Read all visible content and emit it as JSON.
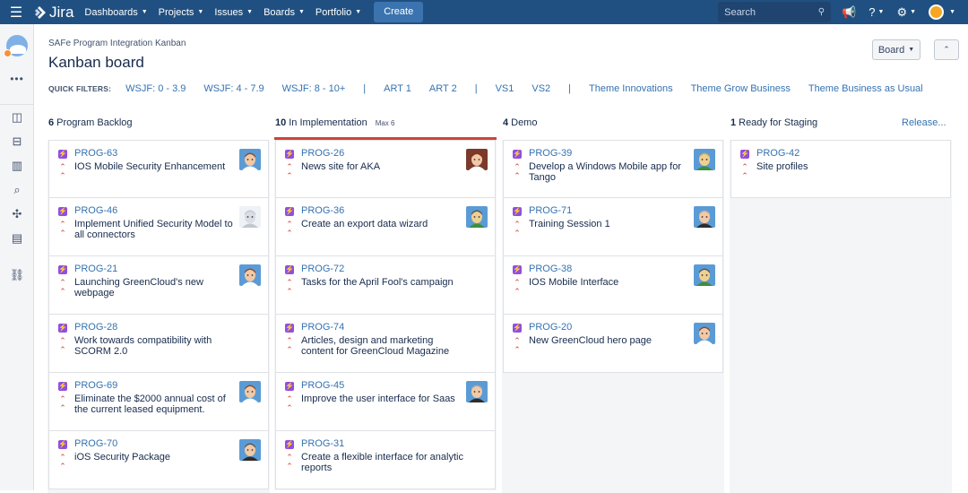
{
  "topbar": {
    "logo_text": "Jira",
    "nav": [
      "Dashboards",
      "Projects",
      "Issues",
      "Boards",
      "Portfolio"
    ],
    "create_label": "Create",
    "search_placeholder": "Search"
  },
  "header": {
    "breadcrumb": "SAFe Program Integration Kanban",
    "title": "Kanban board",
    "board_button": "Board"
  },
  "quick_filters": {
    "label": "QUICK FILTERS:",
    "items": [
      "WSJF: 0 - 3.9",
      "WSJF: 4 - 7.9",
      "WSJF: 8 - 10+",
      "|",
      "ART 1",
      "ART 2",
      "|",
      "VS1",
      "VS2",
      "|",
      "Theme Innovations",
      "Theme Grow Business",
      "Theme Business as Usual"
    ]
  },
  "columns": [
    {
      "count": "6",
      "name": "Program Backlog",
      "max": "",
      "cards": [
        {
          "key": "PROG-63",
          "summary": "IOS Mobile Security Enhancement",
          "avatar": {
            "skin": "#f2c9a6",
            "hair": "#8b4a2b",
            "bg": "#5b9bd5",
            "shirt": "#ffffff"
          }
        },
        {
          "key": "PROG-46",
          "summary": "Implement Unified Security Model to all connectors",
          "avatar": {
            "skin": "#d8dde6",
            "hair": "#c1c7d0",
            "bg": "#eef1f5",
            "shirt": "#c1c7d0"
          }
        },
        {
          "key": "PROG-21",
          "summary": "Launching GreenCloud's new webpage",
          "avatar": {
            "skin": "#f2c9a6",
            "hair": "#8b4a2b",
            "bg": "#5b9bd5",
            "shirt": "#ffffff"
          }
        },
        {
          "key": "PROG-28",
          "summary": "Work towards compatibility with SCORM 2.0",
          "avatar": null
        },
        {
          "key": "PROG-69",
          "summary": "Eliminate the $2000 annual cost of the current leased equipment.",
          "avatar": {
            "skin": "#f2c9a6",
            "hair": "#8b4a2b",
            "bg": "#5b9bd5",
            "shirt": "#ffffff"
          }
        },
        {
          "key": "PROG-70",
          "summary": "iOS Security Package",
          "avatar": {
            "skin": "#f2c9a6",
            "hair": "#555555",
            "bg": "#5b9bd5",
            "shirt": "#2d2d2d"
          }
        }
      ]
    },
    {
      "count": "10",
      "name": "In Implementation",
      "max": "Max 6",
      "cards": [
        {
          "key": "PROG-26",
          "summary": "News site for AKA",
          "avatar": {
            "skin": "#f2c9a6",
            "hair": "#8b2f1a",
            "bg": "#7a3b2b",
            "shirt": "#ffffff"
          }
        },
        {
          "key": "PROG-36",
          "summary": "Create an export data wizard",
          "avatar": {
            "skin": "#f0d090",
            "hair": "#555555",
            "bg": "#5b9bd5",
            "shirt": "#3f8e3f"
          }
        },
        {
          "key": "PROG-72",
          "summary": "Tasks for the April Fool's campaign",
          "avatar": null
        },
        {
          "key": "PROG-74",
          "summary": "Articles, design and marketing content for GreenCloud Magazine",
          "avatar": null
        },
        {
          "key": "PROG-45",
          "summary": "Improve the user interface for Saas",
          "avatar": {
            "skin": "#f2c9a6",
            "hair": "#aaaaaa",
            "bg": "#5b9bd5",
            "shirt": "#2d2d2d"
          }
        },
        {
          "key": "PROG-31",
          "summary": "Create a flexible interface for analytic reports",
          "avatar": null
        }
      ]
    },
    {
      "count": "4",
      "name": "Demo",
      "max": "",
      "cards": [
        {
          "key": "PROG-39",
          "summary": "Develop a Windows Mobile app for Tango",
          "avatar": {
            "skin": "#f0d090",
            "hair": "#c9a36b",
            "bg": "#5b9bd5",
            "shirt": "#3f8e3f"
          }
        },
        {
          "key": "PROG-71",
          "summary": "Training Session 1",
          "avatar": {
            "skin": "#f2c9a6",
            "hair": "#aaaaaa",
            "bg": "#5b9bd5",
            "shirt": "#2d2d2d"
          }
        },
        {
          "key": "PROG-38",
          "summary": "IOS Mobile Interface",
          "avatar": {
            "skin": "#f0d090",
            "hair": "#555555",
            "bg": "#5b9bd5",
            "shirt": "#3f8e3f"
          }
        },
        {
          "key": "PROG-20",
          "summary": "New GreenCloud hero page",
          "avatar": {
            "skin": "#f2c9a6",
            "hair": "#8b4a2b",
            "bg": "#5b9bd5",
            "shirt": "#ffffff"
          }
        }
      ]
    },
    {
      "count": "1",
      "name": "Ready for Staging",
      "max": "",
      "release_label": "Release...",
      "cards": [
        {
          "key": "PROG-42",
          "summary": "Site profiles",
          "avatar": null
        }
      ]
    }
  ],
  "colors": {
    "topbar": "#205081",
    "link": "#3572b0",
    "story": "#904ee2",
    "priority": "#d04437",
    "wip_limit": "#d04437"
  }
}
